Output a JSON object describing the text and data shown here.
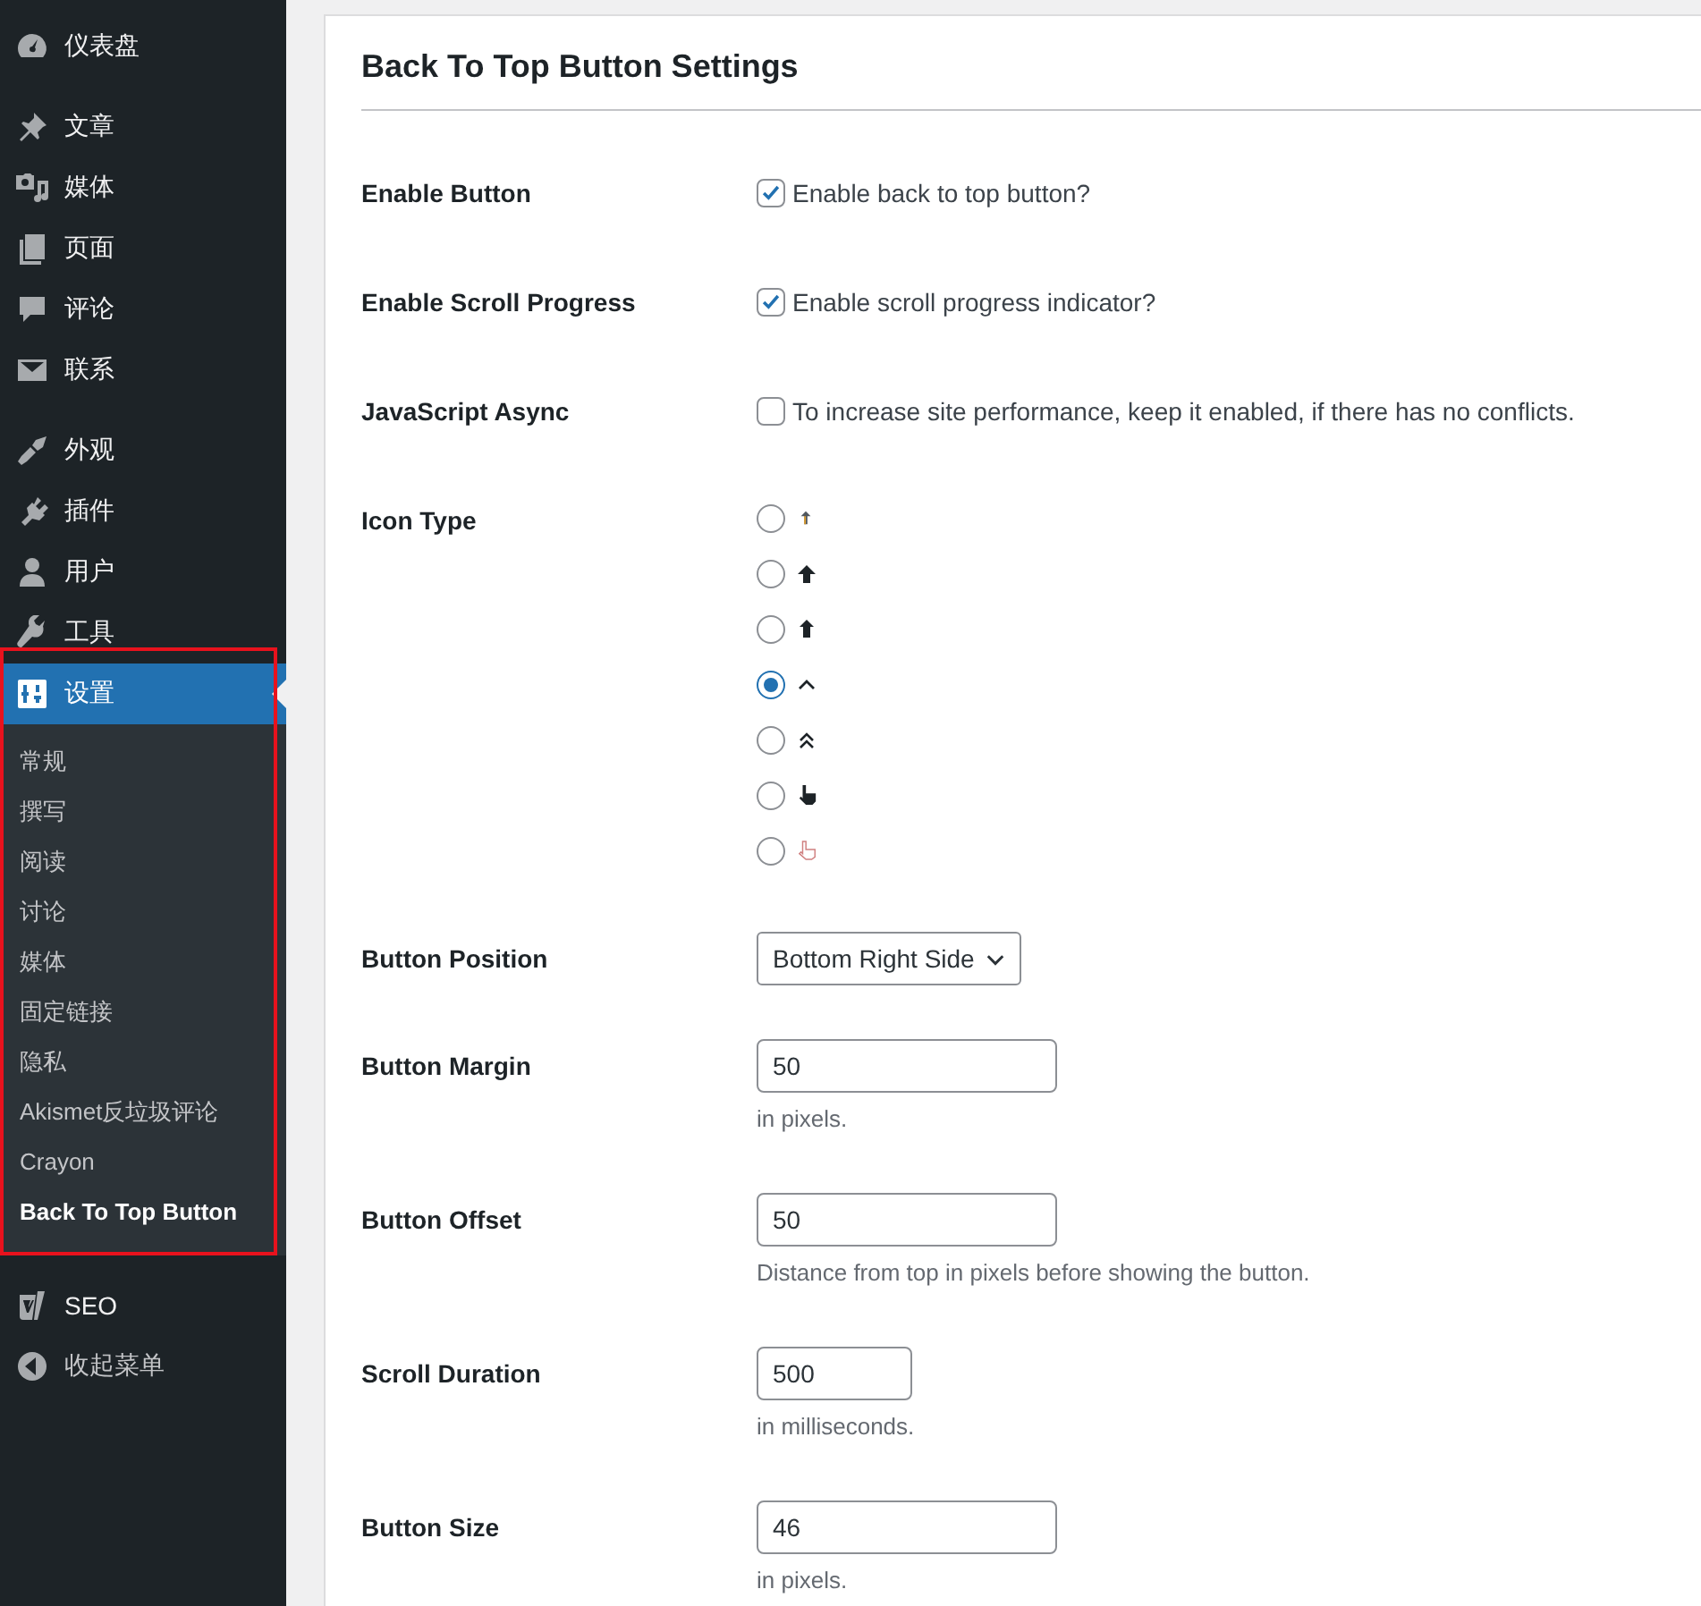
{
  "sidebar": {
    "groups": [
      {
        "items": [
          {
            "label": "仪表盘",
            "selected": false
          }
        ]
      },
      {
        "items": [
          {
            "label": "文章",
            "selected": false
          },
          {
            "label": "媒体",
            "selected": false
          },
          {
            "label": "页面",
            "selected": false
          },
          {
            "label": "评论",
            "selected": false
          },
          {
            "label": "联系",
            "selected": false
          }
        ]
      },
      {
        "items": [
          {
            "label": "外观",
            "selected": false
          },
          {
            "label": "插件",
            "selected": false
          },
          {
            "label": "用户",
            "selected": false
          },
          {
            "label": "工具",
            "selected": false
          },
          {
            "label": "设置",
            "selected": true,
            "highlighted": true,
            "submenu": [
              {
                "label": "常规",
                "selected": false
              },
              {
                "label": "撰写",
                "selected": false
              },
              {
                "label": "阅读",
                "selected": false
              },
              {
                "label": "讨论",
                "selected": false
              },
              {
                "label": "媒体",
                "selected": false
              },
              {
                "label": "固定链接",
                "selected": false
              },
              {
                "label": "隐私",
                "selected": false
              },
              {
                "label": "Akismet反垃圾评论",
                "selected": false
              },
              {
                "label": "Crayon",
                "selected": false
              },
              {
                "label": "Back To Top Button",
                "selected": true
              }
            ]
          }
        ]
      },
      {
        "items": [
          {
            "label": "SEO",
            "selected": false
          }
        ]
      }
    ],
    "collapse": "收起菜单"
  },
  "settings": {
    "title": "Back To Top Button Settings",
    "rows": [
      {
        "kind": "checkbox",
        "label": "Enable Button",
        "checked": true,
        "text": "Enable back to top button?"
      },
      {
        "kind": "checkbox",
        "label": "Enable Scroll Progress",
        "checked": true,
        "text": "Enable scroll progress indicator?"
      },
      {
        "kind": "checkbox",
        "label": "JavaScript Async",
        "checked": false,
        "text": "To increase site performance, keep it enabled, if there has no conflicts."
      },
      {
        "kind": "radio",
        "label": "Icon Type",
        "options": [
          {
            "selected": false
          },
          {
            "selected": false
          },
          {
            "selected": false
          },
          {
            "selected": true
          },
          {
            "selected": false
          },
          {
            "selected": false
          },
          {
            "selected": false
          }
        ]
      },
      {
        "kind": "select",
        "label": "Button Position",
        "value": "Bottom Right Side"
      },
      {
        "kind": "input",
        "label": "Button Margin",
        "value": "50",
        "description": "in pixels."
      },
      {
        "kind": "input",
        "label": "Button Offset",
        "value": "50",
        "description": "Distance from top in pixels before showing the button."
      },
      {
        "kind": "short-input",
        "label": "Scroll Duration",
        "value": "500",
        "description": "in milliseconds."
      },
      {
        "kind": "input",
        "label": "Button Size",
        "value": "46",
        "description": "in pixels."
      }
    ]
  }
}
